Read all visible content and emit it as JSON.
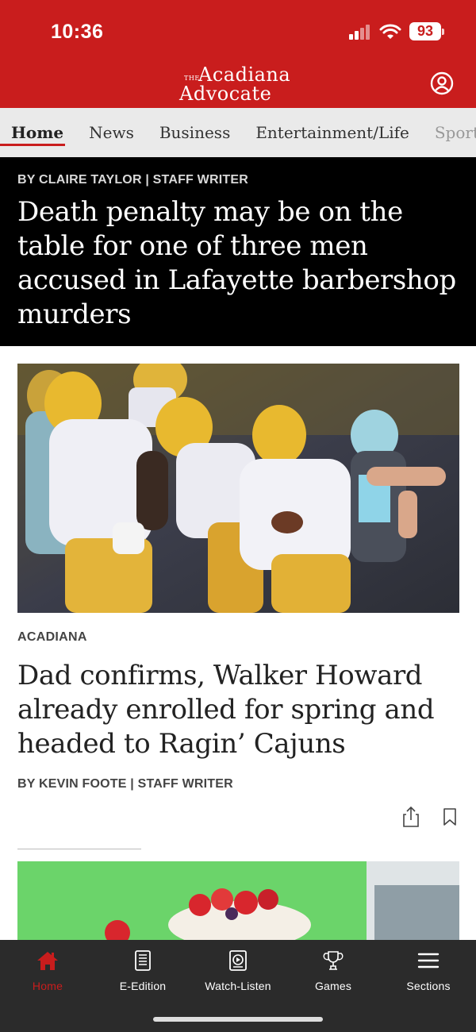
{
  "status_bar": {
    "time": "10:36",
    "battery": "93",
    "signal_icon": "cellular-signal-icon",
    "wifi_icon": "wifi-icon"
  },
  "header": {
    "logo_the": "THE",
    "logo_line1": "Acadiana",
    "logo_line2": "Advocate",
    "account_icon": "account-icon",
    "background_color": "#c91d1d"
  },
  "nav_tabs": [
    {
      "label": "Home",
      "active": true
    },
    {
      "label": "News",
      "active": false
    },
    {
      "label": "Business",
      "active": false
    },
    {
      "label": "Entertainment/Life",
      "active": false
    },
    {
      "label": "Sports",
      "active": false
    }
  ],
  "top_story": {
    "byline": "BY CLAIRE TAYLOR | STAFF WRITER",
    "headline": "Death penalty may be on the table for one of three men accused in Lafayette barbershop murders"
  },
  "story": {
    "section": "ACADIANA",
    "headline": "Dad confirms, Walker Howard already enrolled for spring and headed to Ragin’ Cajuns",
    "byline": "BY KEVIN FOOTE | STAFF WRITER",
    "share_icon": "share-icon",
    "bookmark_icon": "bookmark-icon"
  },
  "bottom_nav": [
    {
      "label": "Home",
      "icon": "home-icon",
      "active": true
    },
    {
      "label": "E-Edition",
      "icon": "newspaper-icon",
      "active": false
    },
    {
      "label": "Watch-Listen",
      "icon": "play-icon",
      "active": false
    },
    {
      "label": "Games",
      "icon": "trophy-icon",
      "active": false
    },
    {
      "label": "Sections",
      "icon": "menu-icon",
      "active": false
    }
  ],
  "colors": {
    "brand_red": "#c91d1d",
    "nav_bg": "#eaeaea",
    "bottom_nav_bg": "#2b2b2b"
  }
}
